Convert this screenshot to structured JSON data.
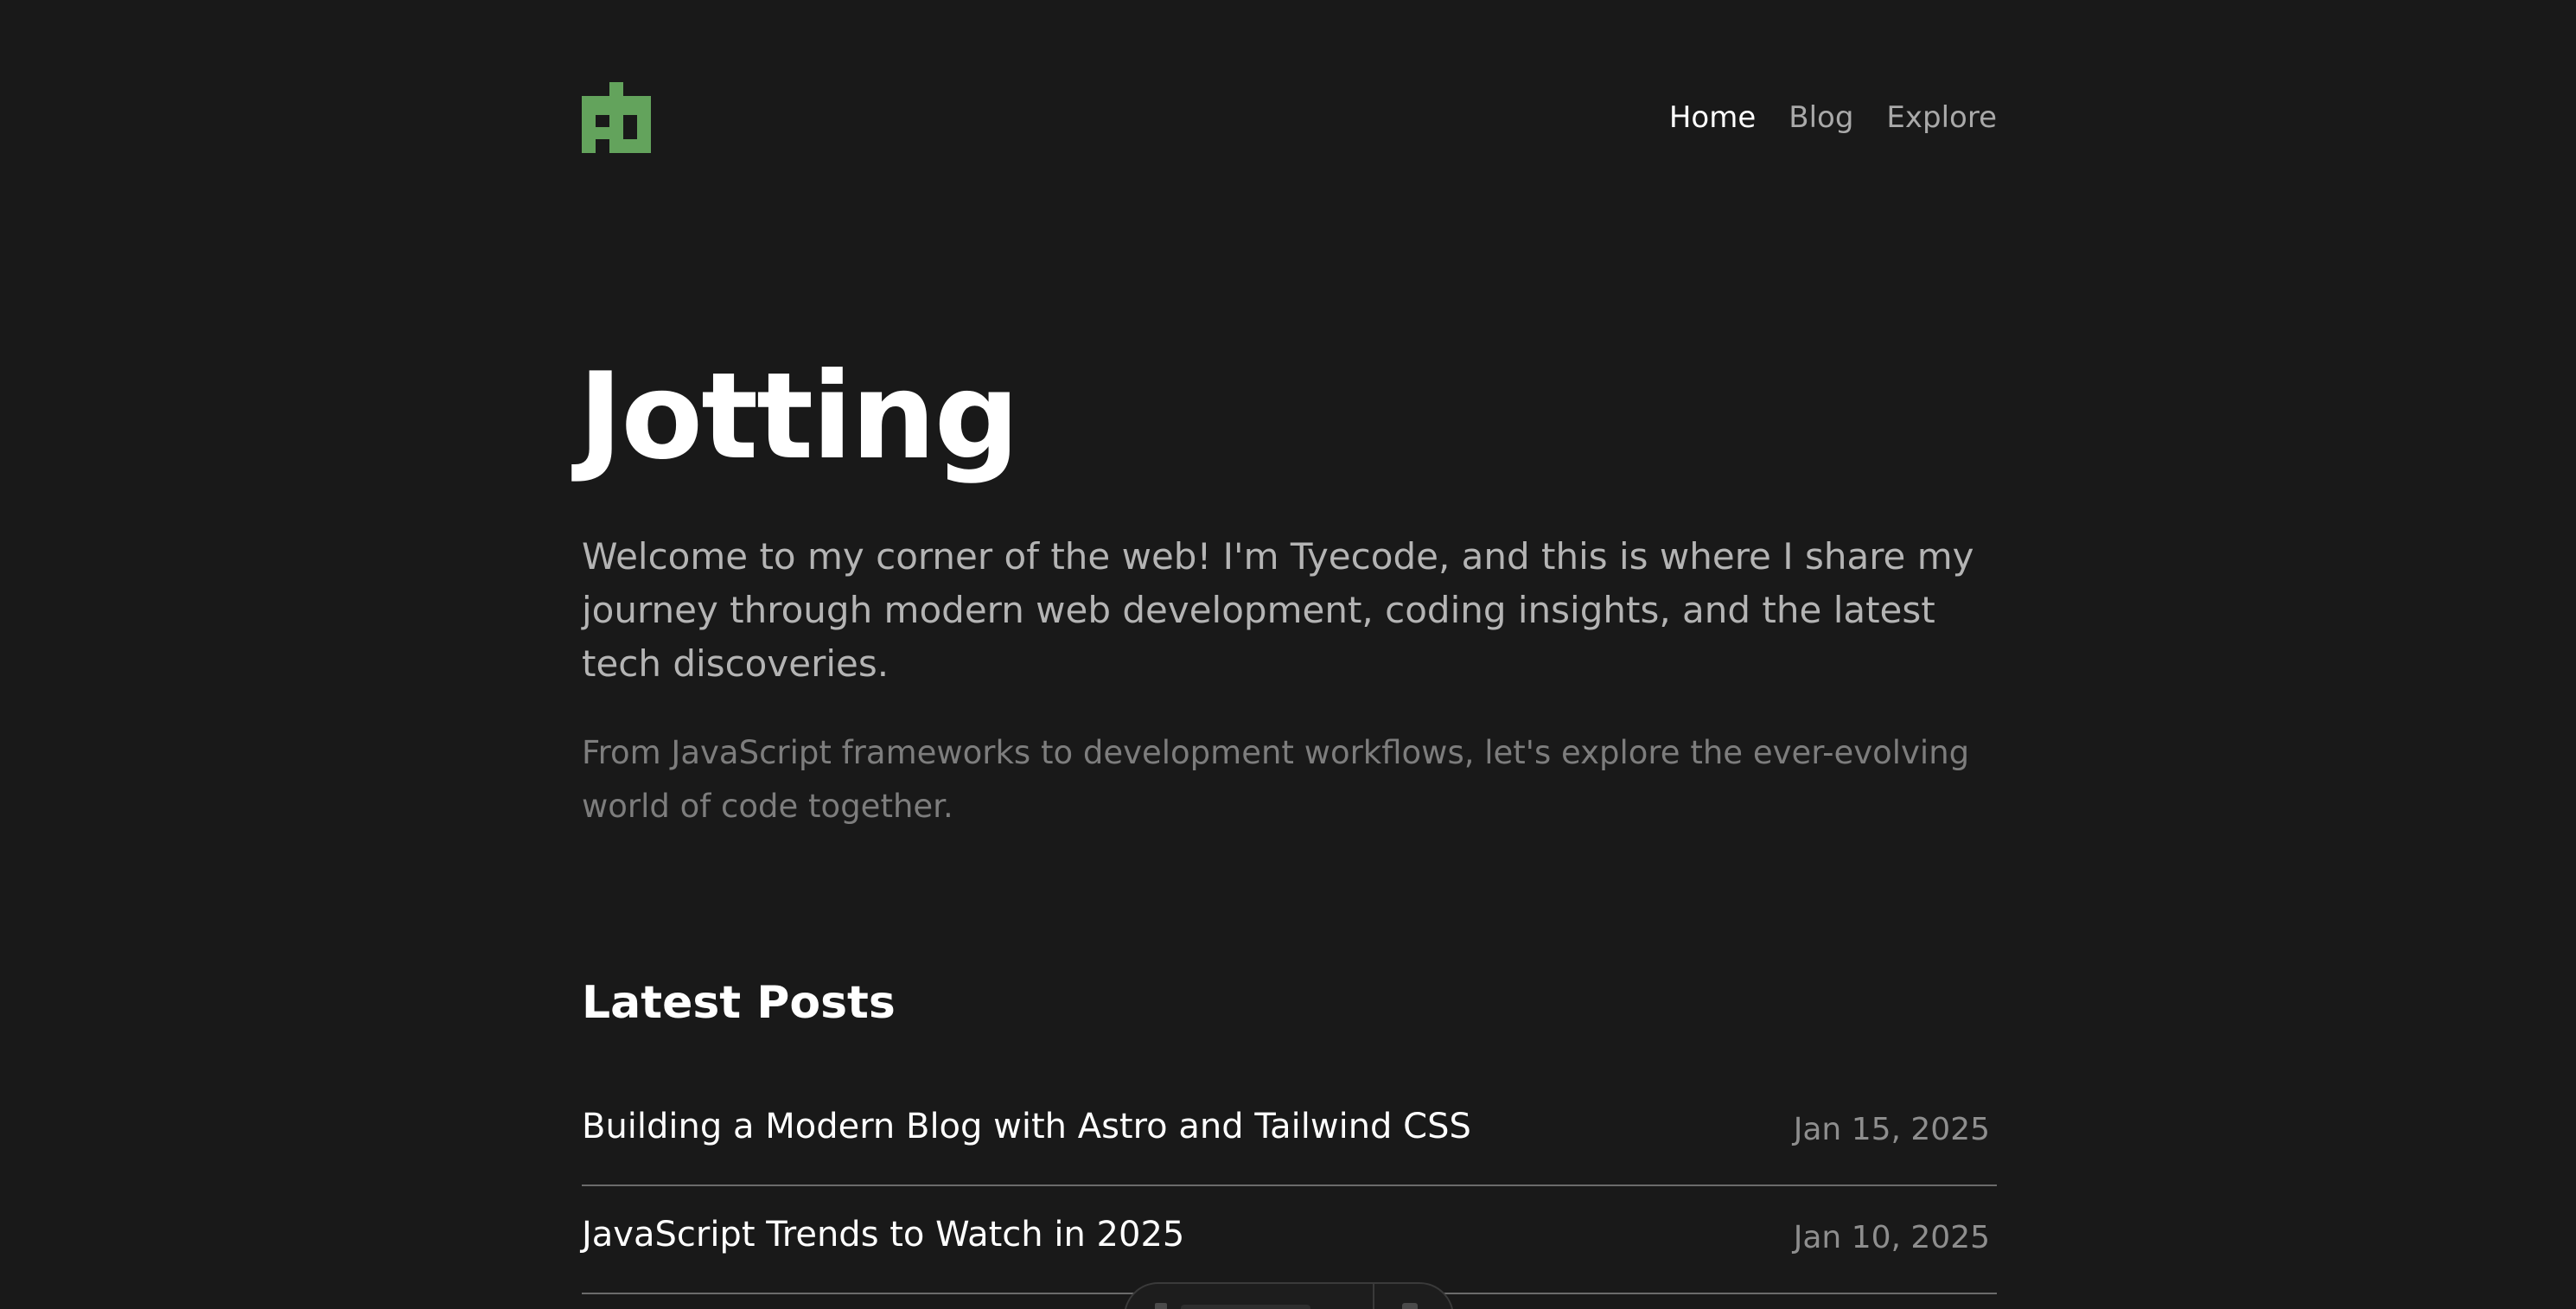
{
  "brand": {
    "logo_color": "#63a35c"
  },
  "nav": {
    "items": [
      {
        "label": "Home",
        "active": true
      },
      {
        "label": "Blog",
        "active": false
      },
      {
        "label": "Explore",
        "active": false
      }
    ]
  },
  "hero": {
    "title": "Jotting",
    "intro": "Welcome to my corner of the web! I'm Tyecode, and this is where I share my journey through modern web development, coding insights, and the latest tech discoveries.",
    "subtext": "From JavaScript frameworks to development workflows, let's explore the ever-evolving world of code together."
  },
  "latest_posts": {
    "heading": "Latest Posts",
    "posts": [
      {
        "title": "Building a Modern Blog with Astro and Tailwind CSS",
        "date": "Jan 15, 2025"
      },
      {
        "title": "JavaScript Trends to Watch in 2025",
        "date": "Jan 10, 2025"
      }
    ]
  },
  "colors": {
    "background": "#191919",
    "text_primary": "#ffffff",
    "text_secondary": "#b4b4b4",
    "text_muted": "#7d7d7d",
    "accent": "#63a35c"
  }
}
